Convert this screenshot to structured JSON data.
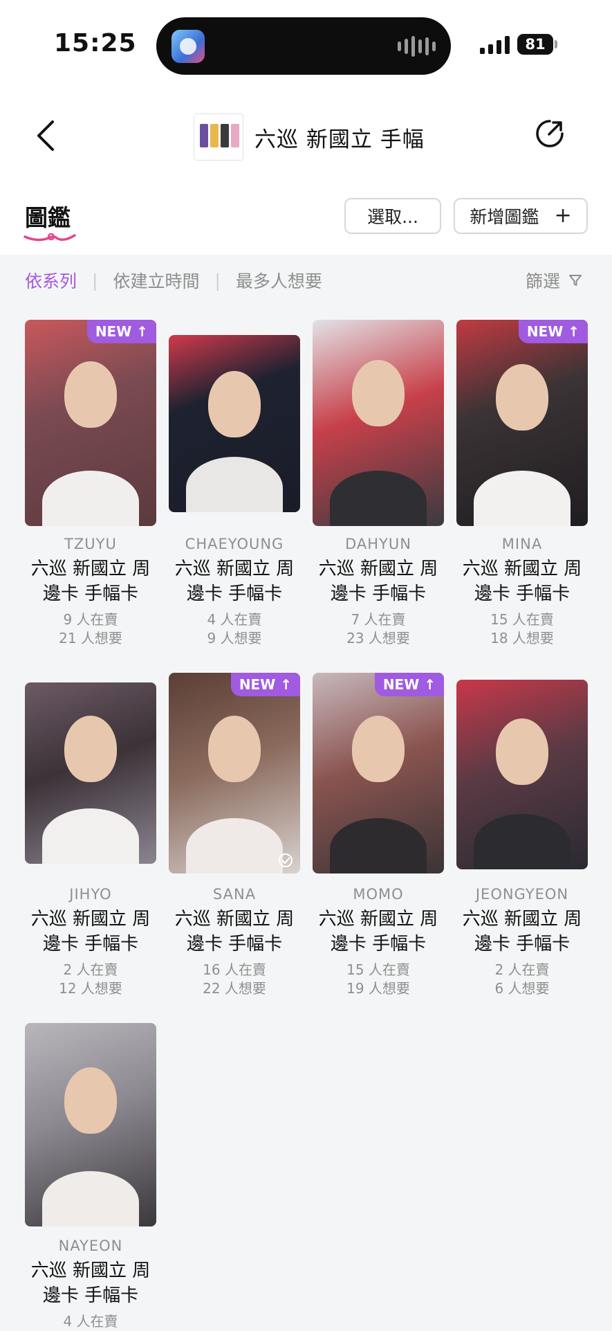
{
  "status": {
    "time": "15:25",
    "battery": "81"
  },
  "nav": {
    "title": "六巡 新國立 手幅"
  },
  "tabs": {
    "title": "圖鑑",
    "select_label": "選取...",
    "add_label": "新增圖鑑"
  },
  "sort": {
    "options": [
      "依系列",
      "依建立時間",
      "最多人想要"
    ],
    "filter_label": "篩選"
  },
  "colors": {
    "accent": "#a05be0",
    "underline": "#e0488f"
  },
  "cards": [
    {
      "name": "TZUYU",
      "title_line1": "六巡 新國立 周",
      "title_line2": "邊卡 手幅卡",
      "selling": "9 人在賣",
      "wanted": "21 人想要",
      "tag": "NEW ↑"
    },
    {
      "name": "CHAEYOUNG",
      "title_line1": "六巡 新國立 周",
      "title_line2": "邊卡 手幅卡",
      "selling": "4 人在賣",
      "wanted": "9 人想要"
    },
    {
      "name": "DAHYUN",
      "title_line1": "六巡 新國立 周",
      "title_line2": "邊卡 手幅卡",
      "selling": "7 人在賣",
      "wanted": "23 人想要"
    },
    {
      "name": "MINA",
      "title_line1": "六巡 新國立 周",
      "title_line2": "邊卡 手幅卡",
      "selling": "15 人在賣",
      "wanted": "18 人想要",
      "tag": "NEW ↑"
    },
    {
      "name": "JIHYO",
      "title_line1": "六巡 新國立 周",
      "title_line2": "邊卡 手幅卡",
      "selling": "2 人在賣",
      "wanted": "12 人想要"
    },
    {
      "name": "SANA",
      "title_line1": "六巡 新國立 周",
      "title_line2": "邊卡 手幅卡",
      "selling": "16 人在賣",
      "wanted": "22 人想要",
      "tag": "NEW ↑"
    },
    {
      "name": "MOMO",
      "title_line1": "六巡 新國立 周",
      "title_line2": "邊卡 手幅卡",
      "selling": "15 人在賣",
      "wanted": "19 人想要",
      "tag": "NEW ↑"
    },
    {
      "name": "JEONGYEON",
      "title_line1": "六巡 新國立 周",
      "title_line2": "邊卡 手幅卡",
      "selling": "2 人在賣",
      "wanted": "6 人想要"
    },
    {
      "name": "NAYEON",
      "title_line1": "六巡 新國立 周",
      "title_line2": "邊卡 手幅卡",
      "selling": "4 人在賣"
    }
  ]
}
